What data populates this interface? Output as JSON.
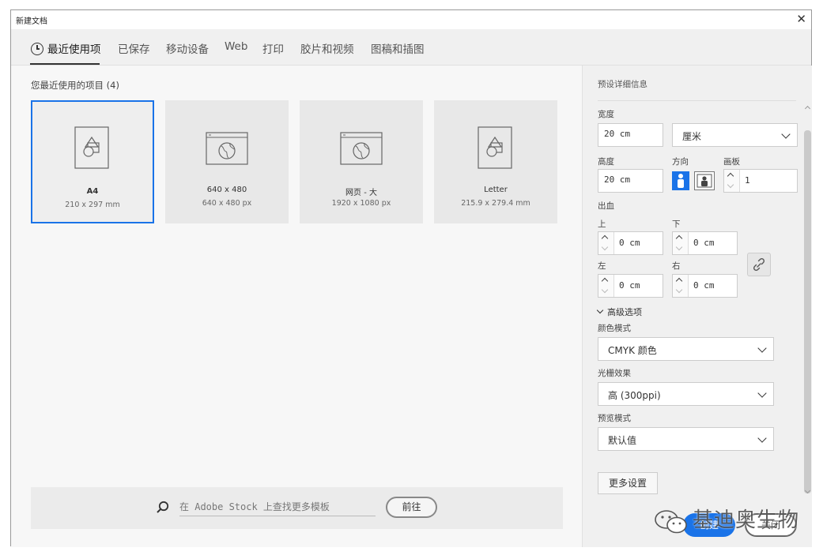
{
  "window": {
    "title": "新建文档"
  },
  "tabs": [
    {
      "label": "最近使用项",
      "active": true
    },
    {
      "label": "已保存"
    },
    {
      "label": "移动设备"
    },
    {
      "label": "Web"
    },
    {
      "label": "打印"
    },
    {
      "label": "胶片和视频"
    },
    {
      "label": "图稿和插图"
    }
  ],
  "recent": {
    "title": "您最近使用的项目 (4)",
    "items": [
      {
        "name": "A4",
        "size": "210 x 297 mm",
        "icon": "document-shapes-icon",
        "selected": true
      },
      {
        "name": "640 x 480",
        "size": "640 x 480 px",
        "icon": "web-globe-icon"
      },
      {
        "name": "网页 - 大",
        "size": "1920 x 1080 px",
        "icon": "web-globe-icon"
      },
      {
        "name": "Letter",
        "size": "215.9 x 279.4 mm",
        "icon": "document-shapes-icon"
      }
    ]
  },
  "stock": {
    "placeholder": "在 Adobe Stock 上查找更多模板",
    "go_label": "前往"
  },
  "details": {
    "title": "预设详细信息",
    "width_label": "宽度",
    "width_value": "20 cm",
    "unit": "厘米",
    "height_label": "高度",
    "height_value": "20 cm",
    "orientation_label": "方向",
    "artboards_label": "画板",
    "artboards_value": "1",
    "bleed_label": "出血",
    "bleed": {
      "top_label": "上",
      "top_value": "0 cm",
      "bottom_label": "下",
      "bottom_value": "0 cm",
      "left_label": "左",
      "left_value": "0 cm",
      "right_label": "右",
      "right_value": "0 cm"
    },
    "advanced_label": "高级选项",
    "color_mode_label": "颜色模式",
    "color_mode_value": "CMYK 颜色",
    "raster_label": "光栅效果",
    "raster_value": "高 (300ppi)",
    "preview_label": "预览模式",
    "preview_value": "默认值",
    "more_label": "更多设置",
    "create_label": "创建",
    "close_label": "关闭"
  },
  "watermark": {
    "text": "基迪奥生物"
  },
  "colors": {
    "accent": "#1a73e8",
    "panel_bg": "#f0f0f0",
    "card_bg": "#e8e8e8"
  }
}
